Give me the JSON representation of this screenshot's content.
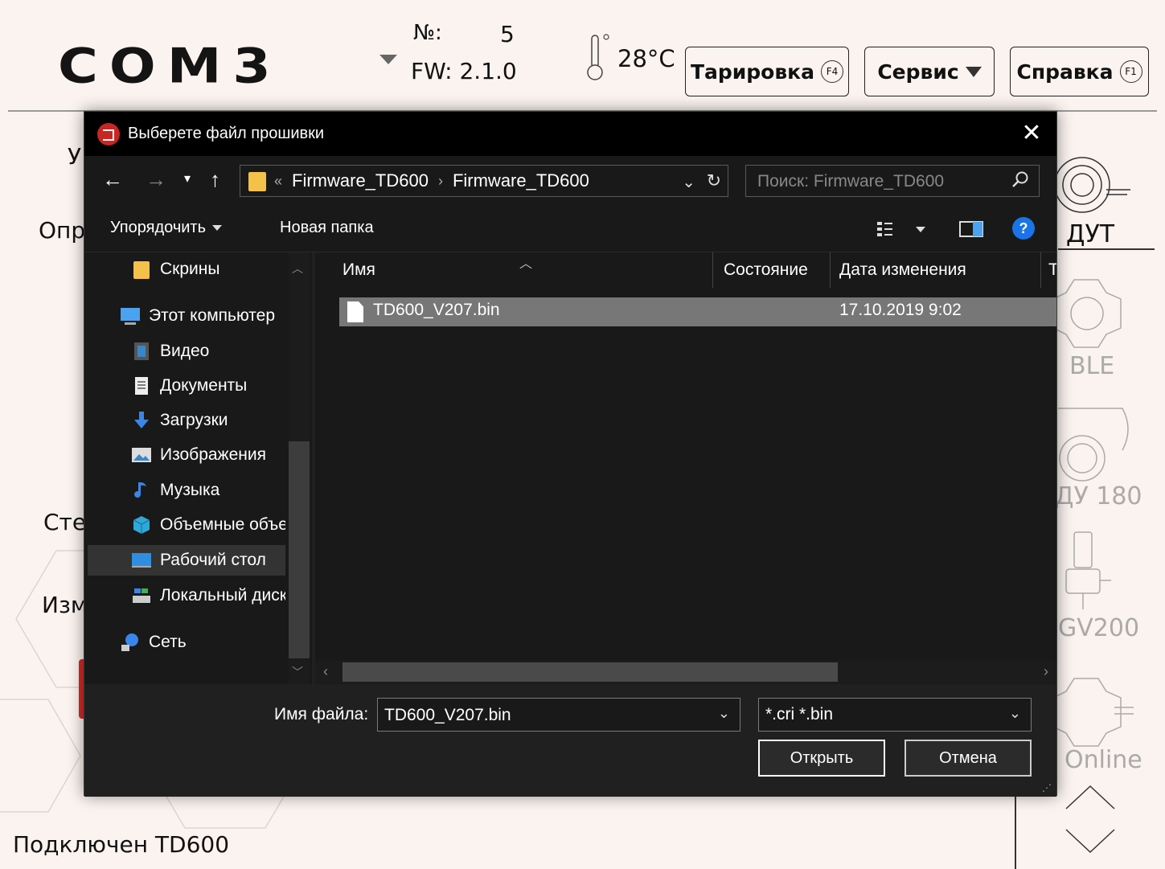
{
  "app": {
    "logo": "COM3",
    "device_no_label": "№:",
    "device_no": "5",
    "fw_label": "FW: 2.1.0",
    "temperature": "28°C",
    "buttons": {
      "tare": "Тарировка",
      "tare_key": "F4",
      "service": "Сервис",
      "help": "Справка",
      "help_key": "F1"
    },
    "left_stubs": [
      "У",
      "Опр",
      "Сте",
      "Изм"
    ],
    "status": "Подключен TD600",
    "devices": [
      {
        "label": "ДУТ",
        "active": true
      },
      {
        "label": "BLE",
        "active": false
      },
      {
        "label": "ДУ 180",
        "active": false
      },
      {
        "label": "GV200",
        "active": false
      },
      {
        "label": "Online",
        "active": false
      }
    ]
  },
  "dialog": {
    "title": "Выберете файл прошивки",
    "close_symbol": "✕",
    "breadcrumb_prefix": "«",
    "breadcrumbs": [
      "Firmware_TD600",
      "Firmware_TD600"
    ],
    "search_placeholder": "Поиск: Firmware_TD600",
    "toolbar": {
      "organize": "Упорядочить",
      "new_folder": "Новая папка"
    },
    "sidebar": [
      {
        "label": "Скрины",
        "icon": "folder-icon"
      },
      {
        "label": "Этот компьютер",
        "icon": "computer-icon"
      },
      {
        "label": "Видео",
        "icon": "video-icon"
      },
      {
        "label": "Документы",
        "icon": "documents-icon"
      },
      {
        "label": "Загрузки",
        "icon": "downloads-icon"
      },
      {
        "label": "Изображения",
        "icon": "pictures-icon"
      },
      {
        "label": "Музыка",
        "icon": "music-icon"
      },
      {
        "label": "Объемные объекты",
        "icon": "3d-objects-icon"
      },
      {
        "label": "Рабочий стол",
        "icon": "desktop-icon"
      },
      {
        "label": "Локальный диск",
        "icon": "local-disk-icon"
      },
      {
        "label": "Сеть",
        "icon": "network-icon"
      }
    ],
    "columns": {
      "name": "Имя",
      "state": "Состояние",
      "date": "Дата изменения",
      "type": "Т"
    },
    "files": [
      {
        "name": "TD600_V207.bin",
        "date": "17.10.2019 9:02"
      }
    ],
    "filename_label": "Имя файла:",
    "filename_value": "TD600_V207.bin",
    "filter_value": "*.cri *.bin",
    "open_button": "Открыть",
    "cancel_button": "Отмена"
  },
  "colors": {
    "app_background": "#fbf3ef",
    "dialog_background": "#202020",
    "title_bar": "#000000",
    "accent_red": "#d42a26",
    "selection": "#777777",
    "help_blue": "#1a73e8"
  }
}
